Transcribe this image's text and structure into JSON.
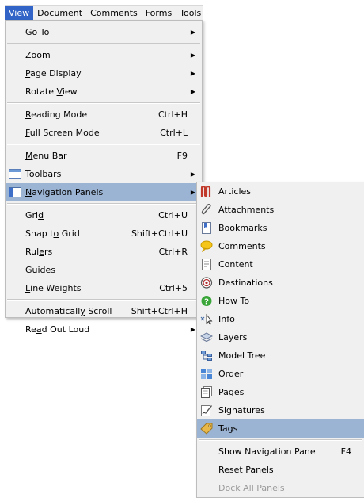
{
  "menubar": {
    "items": [
      "View",
      "Document",
      "Comments",
      "Forms",
      "Tools"
    ],
    "active_index": 0,
    "active_color": "#3164c6"
  },
  "view_menu": {
    "items": [
      {
        "label": "Go To",
        "mnemonic": "G",
        "shortcut": "",
        "submenu": true
      },
      {
        "label": "Zoom",
        "mnemonic": "Z",
        "shortcut": "",
        "submenu": true
      },
      {
        "label": "Page Display",
        "mnemonic": "P",
        "shortcut": "",
        "submenu": true
      },
      {
        "label": "Rotate View",
        "mnemonic": "V",
        "shortcut": "",
        "submenu": true
      },
      {
        "label": "Reading Mode",
        "mnemonic": "R",
        "shortcut": "Ctrl+H",
        "submenu": false
      },
      {
        "label": "Full Screen Mode",
        "mnemonic": "F",
        "shortcut": "Ctrl+L",
        "submenu": false
      },
      {
        "label": "Menu Bar",
        "mnemonic": "M",
        "shortcut": "F9",
        "submenu": false
      },
      {
        "label": "Toolbars",
        "mnemonic": "T",
        "shortcut": "",
        "submenu": true,
        "icon": "toolbar-icon"
      },
      {
        "label": "Navigation Panels",
        "mnemonic": "N",
        "shortcut": "",
        "submenu": true,
        "icon": "navigation-panel-icon",
        "highlighted": true
      },
      {
        "label": "Grid",
        "mnemonic": "d",
        "shortcut": "Ctrl+U",
        "submenu": false
      },
      {
        "label": "Snap to Grid",
        "mnemonic": "o",
        "shortcut": "Shift+Ctrl+U",
        "submenu": false
      },
      {
        "label": "Rulers",
        "mnemonic": "e",
        "shortcut": "Ctrl+R",
        "submenu": false
      },
      {
        "label": "Guides",
        "mnemonic": "s",
        "shortcut": "",
        "submenu": false
      },
      {
        "label": "Line Weights",
        "mnemonic": "L",
        "shortcut": "Ctrl+5",
        "submenu": false
      },
      {
        "label": "Automatically Scroll",
        "mnemonic": "y",
        "shortcut": "Shift+Ctrl+H",
        "submenu": false
      },
      {
        "label": "Read Out Loud",
        "mnemonic": "a",
        "shortcut": "",
        "submenu": true
      }
    ]
  },
  "navigation_panels_menu": {
    "items": [
      {
        "label": "Articles",
        "icon": "articles-icon"
      },
      {
        "label": "Attachments",
        "icon": "paperclip-icon"
      },
      {
        "label": "Bookmarks",
        "icon": "bookmark-icon"
      },
      {
        "label": "Comments",
        "icon": "comment-bubble-icon"
      },
      {
        "label": "Content",
        "icon": "content-icon"
      },
      {
        "label": "Destinations",
        "icon": "destination-icon"
      },
      {
        "label": "How To",
        "icon": "help-icon"
      },
      {
        "label": "Info",
        "icon": "info-cursor-icon"
      },
      {
        "label": "Layers",
        "icon": "layers-icon"
      },
      {
        "label": "Model Tree",
        "icon": "model-tree-icon"
      },
      {
        "label": "Order",
        "icon": "order-icon"
      },
      {
        "label": "Pages",
        "icon": "pages-icon"
      },
      {
        "label": "Signatures",
        "icon": "signature-pen-icon"
      },
      {
        "label": "Tags",
        "icon": "tag-icon",
        "highlighted": true
      }
    ],
    "footer_items": [
      {
        "label": "Show Navigation Pane",
        "shortcut": "F4",
        "disabled": false
      },
      {
        "label": "Reset Panels",
        "shortcut": "",
        "disabled": false
      },
      {
        "label": "Dock All Panels",
        "shortcut": "",
        "disabled": true
      }
    ]
  },
  "colors": {
    "menu_bg": "#f0f0f0",
    "highlight": "#9cb4d4",
    "disabled_text": "#9a9a9a"
  }
}
